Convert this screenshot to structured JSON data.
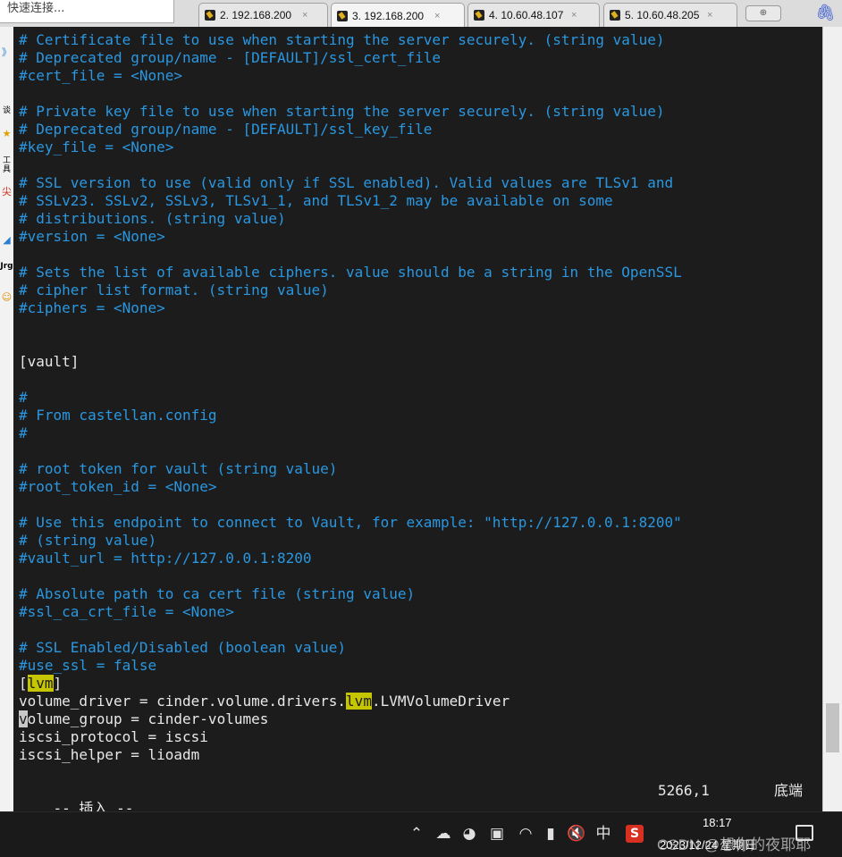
{
  "quick_connect": {
    "placeholder": "快速连接..."
  },
  "tabs": [
    {
      "label": "2. 192.168.200",
      "close": "×",
      "active": false
    },
    {
      "label": "3. 192.168.200",
      "close": "×",
      "active": true
    },
    {
      "label": "4. 10.60.48.107",
      "close": "×",
      "active": false
    },
    {
      "label": "5. 10.60.48.205",
      "close": "×",
      "active": false
    }
  ],
  "new_tab_icon": "plus-icon",
  "attach_icon": "paperclip-icon",
  "left_strip": [
    "》",
    "谈",
    "★",
    "工具",
    "尖",
    "◢",
    "Jrg",
    "☺"
  ],
  "terminal": {
    "lines": [
      "# Certificate file to use when starting the server securely. (string value)",
      "# Deprecated group/name - [DEFAULT]/ssl_cert_file",
      "#cert_file = <None>",
      "",
      "# Private key file to use when starting the server securely. (string value)",
      "# Deprecated group/name - [DEFAULT]/ssl_key_file",
      "#key_file = <None>",
      "",
      "# SSL version to use (valid only if SSL enabled). Valid values are TLSv1 and",
      "# SSLv23. SSLv2, SSLv3, TLSv1_1, and TLSv1_2 may be available on some",
      "# distributions. (string value)",
      "#version = <None>",
      "",
      "# Sets the list of available ciphers. value should be a string in the OpenSSL",
      "# cipher list format. (string value)",
      "#ciphers = <None>",
      "",
      "",
      "[vault]",
      "",
      "#",
      "# From castellan.config",
      "#",
      "",
      "# root token for vault (string value)",
      "#root_token_id = <None>",
      "",
      "# Use this endpoint to connect to Vault, for example: \"http://127.0.0.1:8200\"",
      "# (string value)",
      "#vault_url = http://127.0.0.1:8200",
      "",
      "# Absolute path to ca cert file (string value)",
      "#ssl_ca_crt_file = <None>",
      "",
      "# SSL Enabled/Disabled (boolean value)",
      "#use_ssl = false"
    ],
    "lvm_block": {
      "section_open": "[",
      "section_name": "lvm",
      "section_close": "]",
      "driver_prefix": "volume_driver = cinder.volume.drivers.",
      "driver_match": "lvm",
      "driver_suffix": ".LVMVolumeDriver",
      "group_cursor": "v",
      "group_rest": "olume_group = cinder-volumes",
      "protocol": "iscsi_protocol = iscsi",
      "helper": "iscsi_helper = lioadm"
    },
    "status": {
      "mode": "-- 插入 --",
      "position": "5266,1",
      "percent": "底端"
    }
  },
  "scrollbar": {
    "thumb_position": 0.92
  },
  "taskbar": {
    "icons": [
      "chevron-up-icon",
      "cloud-icon",
      "qq-penguin-icon",
      "screen-share-icon",
      "wifi-icon",
      "battery-icon",
      "mute-icon",
      "ime-zhong",
      "sogou-icon"
    ],
    "ime": "中",
    "sogou": "S",
    "time": "18:17",
    "date": "2023/12/24 星期日",
    "watermark": "CSDN @想你的夜耶耶"
  }
}
